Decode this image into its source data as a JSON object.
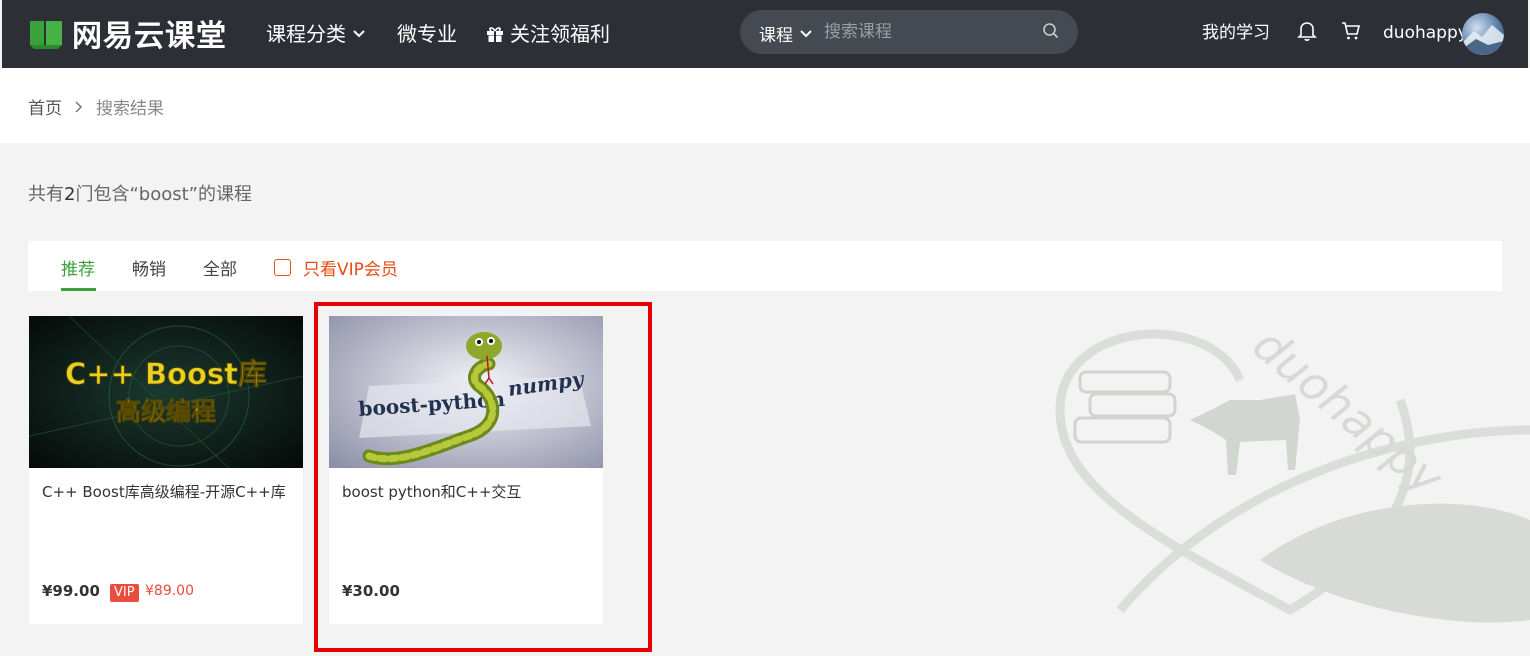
{
  "header": {
    "logo_text": "网易云课堂",
    "nav": {
      "category": "课程分类",
      "micro_major": "微专业",
      "welfare": "关注领福利"
    },
    "search": {
      "category": "课程",
      "placeholder": "搜索课程"
    },
    "my_learning": "我的学习",
    "username": "duohappy"
  },
  "breadcrumb": {
    "home": "首页",
    "current": "搜索结果"
  },
  "result_summary": {
    "prefix": "共有",
    "count": "2",
    "suffix": "门包含“boost”的课程"
  },
  "filters": {
    "tabs": [
      "推荐",
      "畅销",
      "全部"
    ],
    "active_tab": "推荐",
    "vip_only": "只看VIP会员"
  },
  "courses": [
    {
      "thumb_title_line1": "C++ Boost库",
      "thumb_title_line2": "高级编程",
      "title": "C++ Boost库高级编程-开源C++库",
      "price": "¥99.00",
      "vip_label": "VIP",
      "vip_price": "¥89.00"
    },
    {
      "thumb_left_text": "boost-python",
      "thumb_right_text": "numpy",
      "title": "boost python和C++交互",
      "price": "¥30.00"
    }
  ],
  "watermark_text": "duohappy",
  "colors": {
    "header_bg": "#2c2f36",
    "accent_green": "#3ba13b",
    "vip_orange": "#e84d15",
    "highlight_red": "#e60000"
  }
}
